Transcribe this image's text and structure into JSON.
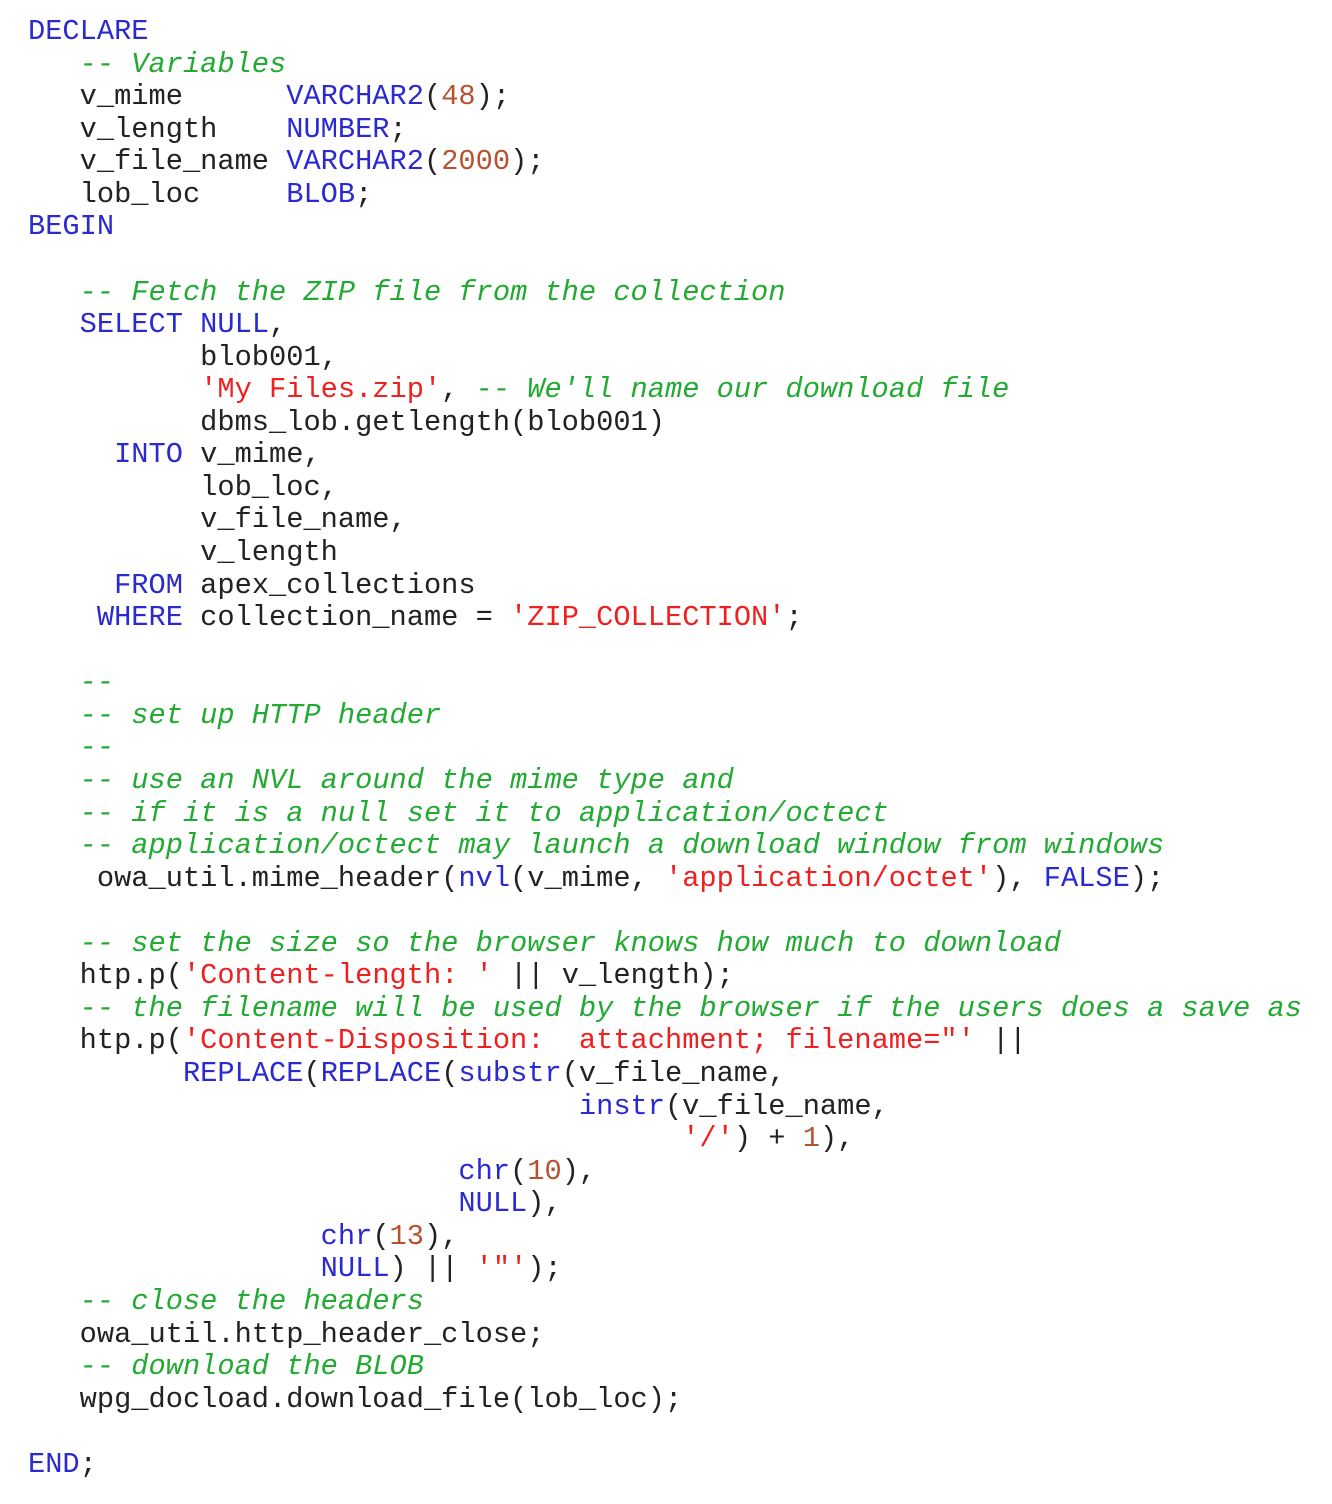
{
  "document": {
    "language": "PL/SQL",
    "colors": {
      "keyword": "#2a2ad0",
      "string": "#ee2020",
      "number": "#b5532f",
      "comment": "#22aa33",
      "identifier": "#222222",
      "background": "#ffffff"
    },
    "lines": [
      [
        [
          "kw",
          "DECLARE"
        ]
      ],
      [
        [
          "id",
          "   "
        ],
        [
          "cmt",
          "-- Variables"
        ]
      ],
      [
        [
          "id",
          "   v_mime      "
        ],
        [
          "kw",
          "VARCHAR2"
        ],
        [
          "id",
          "("
        ],
        [
          "num",
          "48"
        ],
        [
          "id",
          ");"
        ]
      ],
      [
        [
          "id",
          "   v_length    "
        ],
        [
          "kw",
          "NUMBER"
        ],
        [
          "id",
          ";"
        ]
      ],
      [
        [
          "id",
          "   v_file_name "
        ],
        [
          "kw",
          "VARCHAR2"
        ],
        [
          "id",
          "("
        ],
        [
          "num",
          "2000"
        ],
        [
          "id",
          ");"
        ]
      ],
      [
        [
          "id",
          "   lob_loc     "
        ],
        [
          "kw",
          "BLOB"
        ],
        [
          "id",
          ";"
        ]
      ],
      [
        [
          "kw",
          "BEGIN"
        ]
      ],
      [],
      [
        [
          "id",
          "   "
        ],
        [
          "cmt",
          "-- Fetch the ZIP file from the collection"
        ]
      ],
      [
        [
          "id",
          "   "
        ],
        [
          "kw",
          "SELECT"
        ],
        [
          "id",
          " "
        ],
        [
          "kw",
          "NULL"
        ],
        [
          "id",
          ","
        ]
      ],
      [
        [
          "id",
          "          blob001,"
        ]
      ],
      [
        [
          "id",
          "          "
        ],
        [
          "str",
          "'My Files.zip'"
        ],
        [
          "id",
          ", "
        ],
        [
          "cmt",
          "-- We'll name our download file"
        ]
      ],
      [
        [
          "id",
          "          dbms_lob.getlength(blob001)"
        ]
      ],
      [
        [
          "id",
          "     "
        ],
        [
          "kw",
          "INTO"
        ],
        [
          "id",
          " v_mime,"
        ]
      ],
      [
        [
          "id",
          "          lob_loc,"
        ]
      ],
      [
        [
          "id",
          "          v_file_name,"
        ]
      ],
      [
        [
          "id",
          "          v_length"
        ]
      ],
      [
        [
          "id",
          "     "
        ],
        [
          "kw",
          "FROM"
        ],
        [
          "id",
          " apex_collections"
        ]
      ],
      [
        [
          "id",
          "    "
        ],
        [
          "kw",
          "WHERE"
        ],
        [
          "id",
          " collection_name = "
        ],
        [
          "str",
          "'ZIP_COLLECTION'"
        ],
        [
          "id",
          ";"
        ]
      ],
      [],
      [
        [
          "id",
          "   "
        ],
        [
          "cmt",
          "--"
        ]
      ],
      [
        [
          "id",
          "   "
        ],
        [
          "cmt",
          "-- set up HTTP header"
        ]
      ],
      [
        [
          "id",
          "   "
        ],
        [
          "cmt",
          "--"
        ]
      ],
      [
        [
          "id",
          "   "
        ],
        [
          "cmt",
          "-- use an NVL around the mime type and"
        ]
      ],
      [
        [
          "id",
          "   "
        ],
        [
          "cmt",
          "-- if it is a null set it to application/octect"
        ]
      ],
      [
        [
          "id",
          "   "
        ],
        [
          "cmt",
          "-- application/octect may launch a download window from windows"
        ]
      ],
      [
        [
          "id",
          "    owa_util.mime_header("
        ],
        [
          "kw",
          "nvl"
        ],
        [
          "id",
          "(v_mime, "
        ],
        [
          "str",
          "'application/octet'"
        ],
        [
          "id",
          "), "
        ],
        [
          "kw",
          "FALSE"
        ],
        [
          "id",
          ");"
        ]
      ],
      [],
      [
        [
          "id",
          "   "
        ],
        [
          "cmt",
          "-- set the size so the browser knows how much to download"
        ]
      ],
      [
        [
          "id",
          "   htp.p("
        ],
        [
          "str",
          "'Content-length: '"
        ],
        [
          "id",
          " || v_length);"
        ]
      ],
      [
        [
          "id",
          "   "
        ],
        [
          "cmt",
          "-- the filename will be used by the browser if the users does a save as"
        ]
      ],
      [
        [
          "id",
          "   htp.p("
        ],
        [
          "str",
          "'Content-Disposition:  attachment; filename=\"'"
        ],
        [
          "id",
          " ||"
        ]
      ],
      [
        [
          "id",
          "         "
        ],
        [
          "kw",
          "REPLACE"
        ],
        [
          "id",
          "("
        ],
        [
          "kw",
          "REPLACE"
        ],
        [
          "id",
          "("
        ],
        [
          "kw",
          "substr"
        ],
        [
          "id",
          "(v_file_name,"
        ]
      ],
      [
        [
          "id",
          "                                "
        ],
        [
          "kw",
          "instr"
        ],
        [
          "id",
          "(v_file_name,"
        ]
      ],
      [
        [
          "id",
          "                                      "
        ],
        [
          "str",
          "'/'"
        ],
        [
          "id",
          ") + "
        ],
        [
          "num",
          "1"
        ],
        [
          "id",
          "),"
        ]
      ],
      [
        [
          "id",
          "                         "
        ],
        [
          "kw",
          "chr"
        ],
        [
          "id",
          "("
        ],
        [
          "num",
          "10"
        ],
        [
          "id",
          "),"
        ]
      ],
      [
        [
          "id",
          "                         "
        ],
        [
          "kw",
          "NULL"
        ],
        [
          "id",
          "),"
        ]
      ],
      [
        [
          "id",
          "                 "
        ],
        [
          "kw",
          "chr"
        ],
        [
          "id",
          "("
        ],
        [
          "num",
          "13"
        ],
        [
          "id",
          "),"
        ]
      ],
      [
        [
          "id",
          "                 "
        ],
        [
          "kw",
          "NULL"
        ],
        [
          "id",
          ") || "
        ],
        [
          "str",
          "'\"'"
        ],
        [
          "id",
          ");"
        ]
      ],
      [
        [
          "id",
          "   "
        ],
        [
          "cmt",
          "-- close the headers"
        ]
      ],
      [
        [
          "id",
          "   owa_util.http_header_close;"
        ]
      ],
      [
        [
          "id",
          "   "
        ],
        [
          "cmt",
          "-- download the BLOB"
        ]
      ],
      [
        [
          "id",
          "   wpg_docload.download_file(lob_loc);"
        ]
      ],
      [],
      [
        [
          "kw",
          "END"
        ],
        [
          "id",
          ";"
        ]
      ]
    ]
  }
}
